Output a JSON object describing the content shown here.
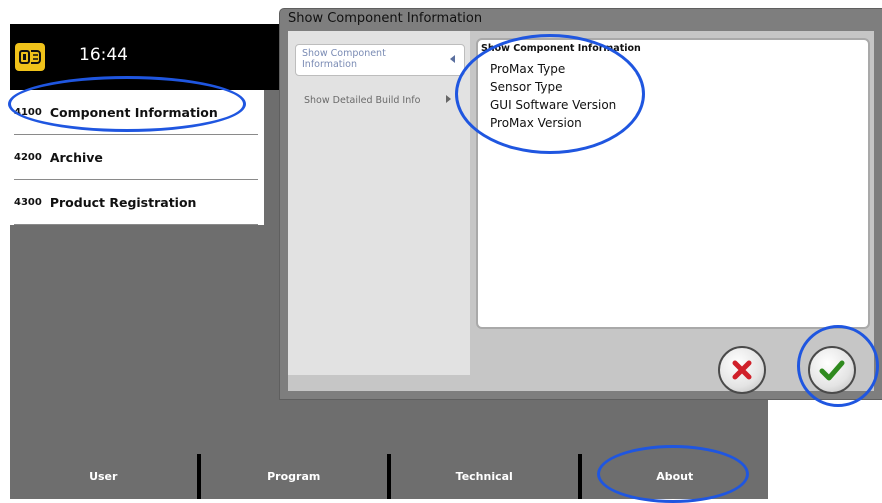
{
  "header": {
    "clock": "16:44"
  },
  "menu": {
    "items": [
      {
        "code": "4100",
        "label": "Component Information"
      },
      {
        "code": "4200",
        "label": "Archive"
      },
      {
        "code": "4300",
        "label": "Product Registration"
      }
    ]
  },
  "tabs": [
    {
      "label": "User"
    },
    {
      "label": "Program"
    },
    {
      "label": "Technical"
    },
    {
      "label": "About"
    }
  ],
  "dialog": {
    "title": "Show Component Information",
    "nav": [
      {
        "label": "Show Component Information"
      },
      {
        "label": "Show Detailed Build Info"
      }
    ],
    "info": {
      "title": "Show Component Information",
      "lines": [
        "ProMax Type",
        "Sensor Type",
        "GUI Software Version",
        "ProMax Version"
      ]
    }
  },
  "colors": {
    "highlight": "#1f56e0",
    "logo": "#f0c21a",
    "cancel": "#d0202a",
    "ok": "#2f8a1e"
  },
  "icons": {
    "logo": "planmeca-logo-icon",
    "cancel": "close-icon",
    "ok": "checkmark-icon",
    "nav_selected": "arrow-left-icon",
    "nav_plain": "arrow-right-icon"
  }
}
